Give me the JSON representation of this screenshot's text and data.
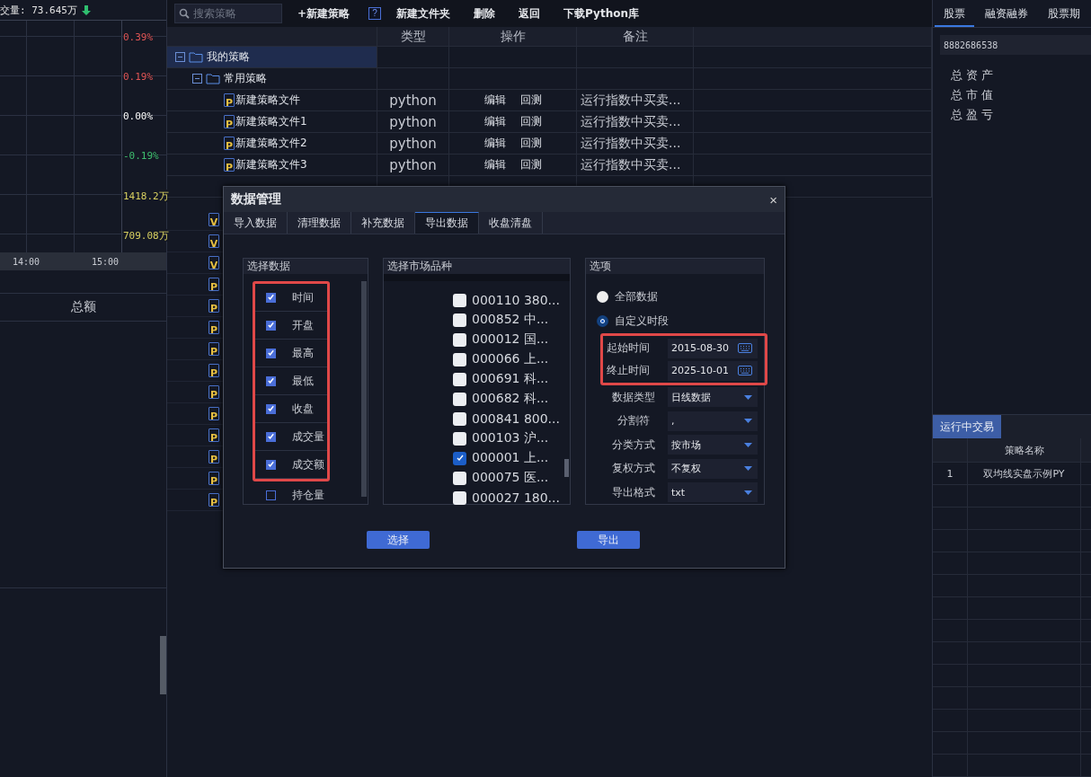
{
  "chart_panel": {
    "title": "交量: 73.645万",
    "axis_labels": [
      {
        "text": "0.39%",
        "color": "#e05555"
      },
      {
        "text": "0.19%",
        "color": "#e05555"
      },
      {
        "text": "0.00%",
        "color": "#ffffff"
      },
      {
        "text": "-0.19%",
        "color": "#3fbf6f"
      },
      {
        "text": "1418.2万",
        "color": "#d8d060"
      },
      {
        "text": "709.08万",
        "color": "#d8d060"
      }
    ],
    "time_labels": [
      "14:00",
      "15:00"
    ],
    "footer_label": "总额"
  },
  "toolbar": {
    "search": {
      "placeholder": "搜索策略"
    },
    "buttons": [
      {
        "kind": "text",
        "label": "+新建策略"
      },
      {
        "kind": "help",
        "label": "?"
      },
      {
        "kind": "text",
        "label": "新建文件夹"
      },
      {
        "kind": "text",
        "label": "删除"
      },
      {
        "kind": "text",
        "label": "返回"
      },
      {
        "kind": "text",
        "label": "下载Python库"
      }
    ]
  },
  "table": {
    "columns": [
      "类型",
      "操作",
      "备注"
    ],
    "tree": [
      {
        "label": "我的策略",
        "expanded": true,
        "selected": true,
        "children": [
          {
            "label": "常用策略",
            "expanded": true,
            "selected": false,
            "files": [
              {
                "icon": "P",
                "name": "新建策略文件",
                "type": "python",
                "actions": [
                  "编辑",
                  "回测"
                ],
                "note": "运行指数中买卖..."
              },
              {
                "icon": "P",
                "name": "新建策略文件1",
                "type": "python",
                "actions": [
                  "编辑",
                  "回测"
                ],
                "note": "运行指数中买卖..."
              },
              {
                "icon": "P",
                "name": "新建策略文件2",
                "type": "python",
                "actions": [
                  "编辑",
                  "回测"
                ],
                "note": "运行指数中买卖..."
              },
              {
                "icon": "P",
                "name": "新建策略文件3",
                "type": "python",
                "actions": [
                  "编辑",
                  "回测"
                ],
                "note": "运行指数中买卖..."
              }
            ]
          }
        ]
      }
    ],
    "covered_files": [
      "V",
      "V",
      "V",
      "P",
      "P",
      "P",
      "P",
      "P",
      "P",
      "P",
      "P",
      "P",
      "P",
      "P"
    ]
  },
  "right_panel": {
    "tabs": [
      {
        "label": "股票",
        "selected": true
      },
      {
        "label": "融资融券",
        "selected": false
      },
      {
        "label": "股票期",
        "selected": false
      }
    ],
    "account": "8882686538",
    "summary": [
      "总 资 产",
      "总 市 值",
      "总 盈 亏"
    ],
    "running": {
      "tab": "运行中交易",
      "columns": [
        "策略名称"
      ],
      "rows": [
        {
          "index": "1",
          "name": "双均线实盘示例PY"
        }
      ]
    }
  },
  "dialog": {
    "title": "数据管理",
    "close": "×",
    "tabs": [
      {
        "label": "导入数据",
        "selected": false
      },
      {
        "label": "清理数据",
        "selected": false
      },
      {
        "label": "补充数据",
        "selected": false
      },
      {
        "label": "导出数据",
        "selected": true
      },
      {
        "label": "收盘清盘",
        "selected": false
      }
    ],
    "fields_panel": {
      "title": "选择数据",
      "items": [
        {
          "label": "时间",
          "checked": true
        },
        {
          "label": "开盘",
          "checked": true
        },
        {
          "label": "最高",
          "checked": true
        },
        {
          "label": "最低",
          "checked": true
        },
        {
          "label": "收盘",
          "checked": true
        },
        {
          "label": "成交量",
          "checked": true
        },
        {
          "label": "成交额",
          "checked": true
        },
        {
          "label": "持仓量",
          "checked": false
        }
      ]
    },
    "market_panel": {
      "title": "选择市场品种",
      "items": [
        {
          "label": "000110 380...",
          "checked": false
        },
        {
          "label": "000852 中...",
          "checked": false
        },
        {
          "label": "000012 国...",
          "checked": false
        },
        {
          "label": "000066 上...",
          "checked": false
        },
        {
          "label": "000691 科...",
          "checked": false
        },
        {
          "label": "000682 科...",
          "checked": false
        },
        {
          "label": "000841 800...",
          "checked": false
        },
        {
          "label": "000103 沪...",
          "checked": false
        },
        {
          "label": "000001 上...",
          "checked": true
        },
        {
          "label": "000075 医...",
          "checked": false
        },
        {
          "label": "000027 180...",
          "checked": false
        }
      ]
    },
    "options": {
      "title": "选项",
      "ranges": [
        {
          "label": "全部数据",
          "selected": false
        },
        {
          "label": "自定义时段",
          "selected": true
        }
      ],
      "dates": [
        {
          "label": "起始时间",
          "value": "2015-08-30"
        },
        {
          "label": "终止时间",
          "value": "2025-10-01"
        }
      ],
      "selects": [
        {
          "label": "数据类型",
          "value": "日线数据"
        },
        {
          "label": "分割符",
          "value": ","
        },
        {
          "label": "分类方式",
          "value": "按市场"
        },
        {
          "label": "复权方式",
          "value": "不复权"
        },
        {
          "label": "导出格式",
          "value": "txt"
        }
      ]
    },
    "buttons": [
      "选择",
      "导出"
    ]
  }
}
